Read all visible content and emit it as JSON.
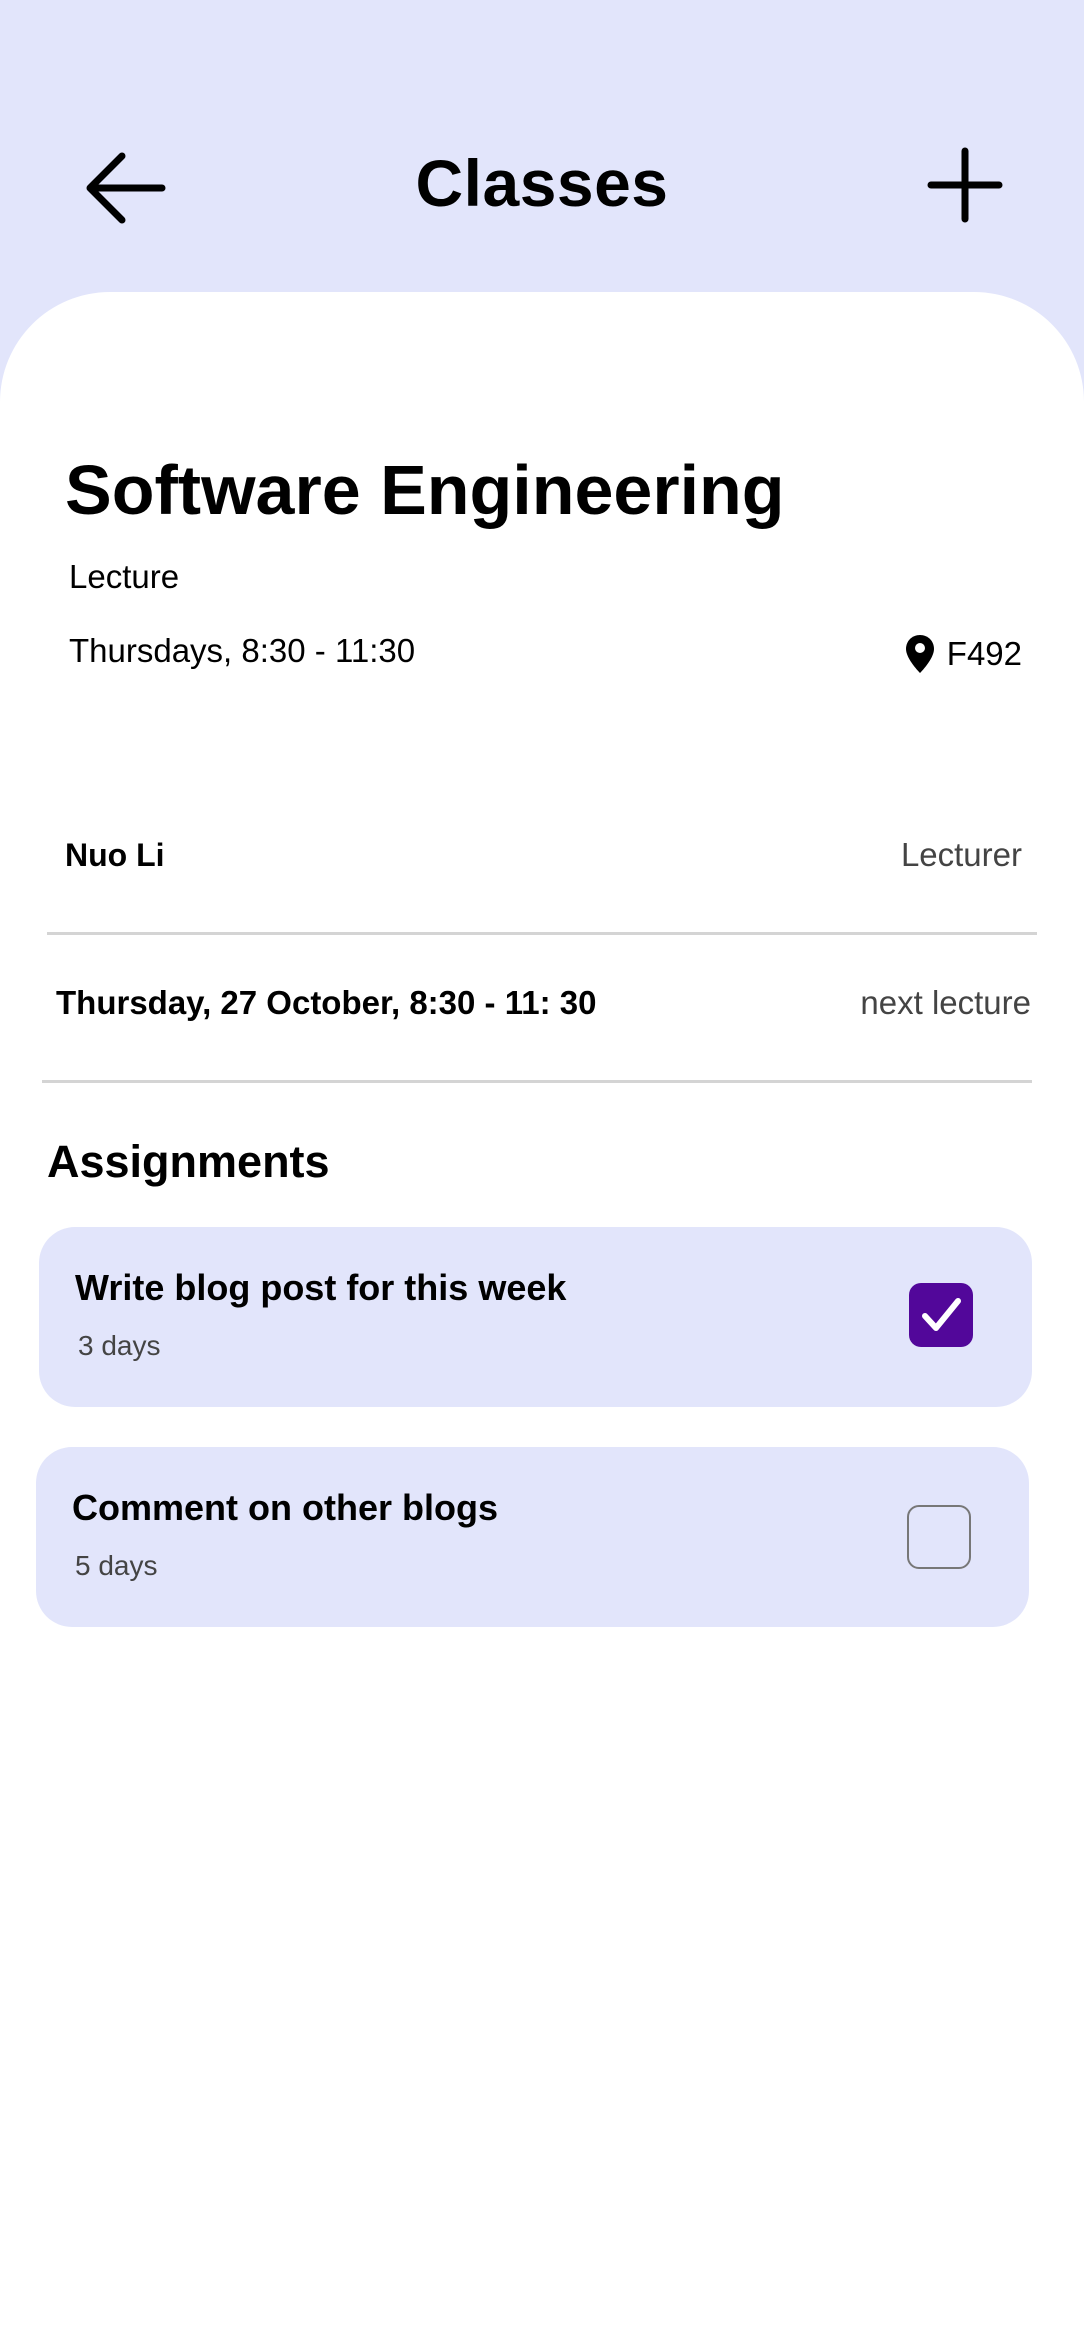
{
  "header": {
    "title": "Classes",
    "back_icon": "arrow-left-icon",
    "add_icon": "plus-icon"
  },
  "course": {
    "title": "Software Engineering",
    "type": "Lecture",
    "schedule": "Thursdays, 8:30 - 11:30",
    "room": "F492",
    "room_icon": "location-pin-icon"
  },
  "lecturer": {
    "name": "Nuo Li",
    "role": "Lecturer"
  },
  "next_lecture": {
    "date": "Thursday, 27 October, 8:30 - 11: 30",
    "label": "next lecture"
  },
  "assignments": {
    "heading": "Assignments",
    "items": [
      {
        "title": "Write blog post for this week",
        "due": "3 days",
        "checked": true
      },
      {
        "title": "Comment on other blogs",
        "due": "5 days",
        "checked": false
      }
    ]
  },
  "colors": {
    "header_bg": "#e2e5fb",
    "card_bg": "#e2e5fb",
    "checkbox_checked": "#52079a"
  }
}
